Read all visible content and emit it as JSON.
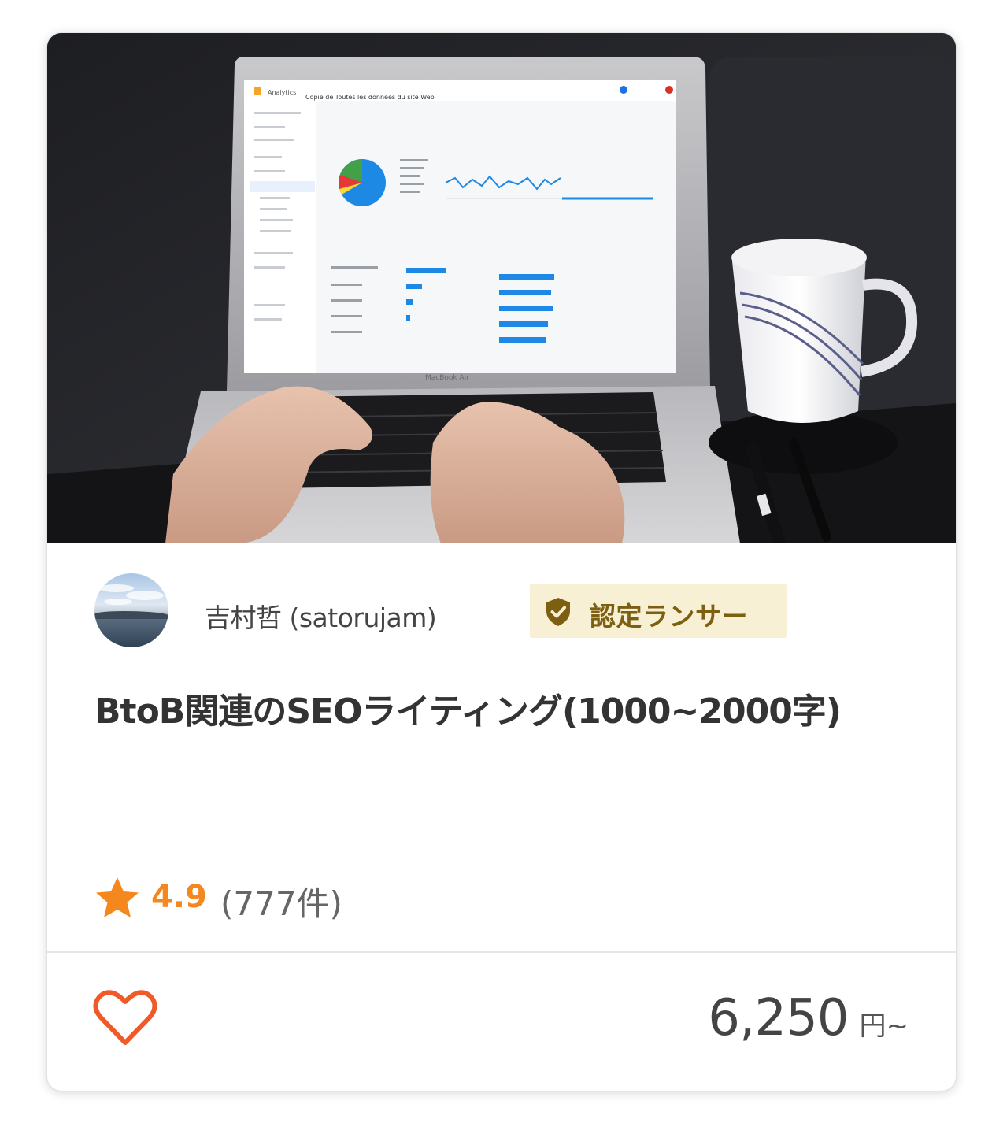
{
  "card": {
    "thumbnail": {
      "alt": "laptop-analytics-photo",
      "screen_heading": "Copie de Toutes les données du site Web",
      "screen_brand": "Analytics",
      "laptop_label": "MacBook Air"
    },
    "seller": {
      "name": "吉村哲 (satorujam)",
      "badge_label": "認定ランサー",
      "badge_icon": "shield-check-icon",
      "badge_bg": "#f7f0d4",
      "badge_color": "#7d5f12"
    },
    "title": "BtoB関連のSEOライティング(1000~2000字)",
    "rating": {
      "icon": "star-icon",
      "score": "4.9",
      "count": "(777件)",
      "color": "#f5871f"
    },
    "favorite": {
      "icon": "heart-outline-icon",
      "color": "#f05a28"
    },
    "price": {
      "amount": "6,250",
      "unit": "円~"
    }
  }
}
